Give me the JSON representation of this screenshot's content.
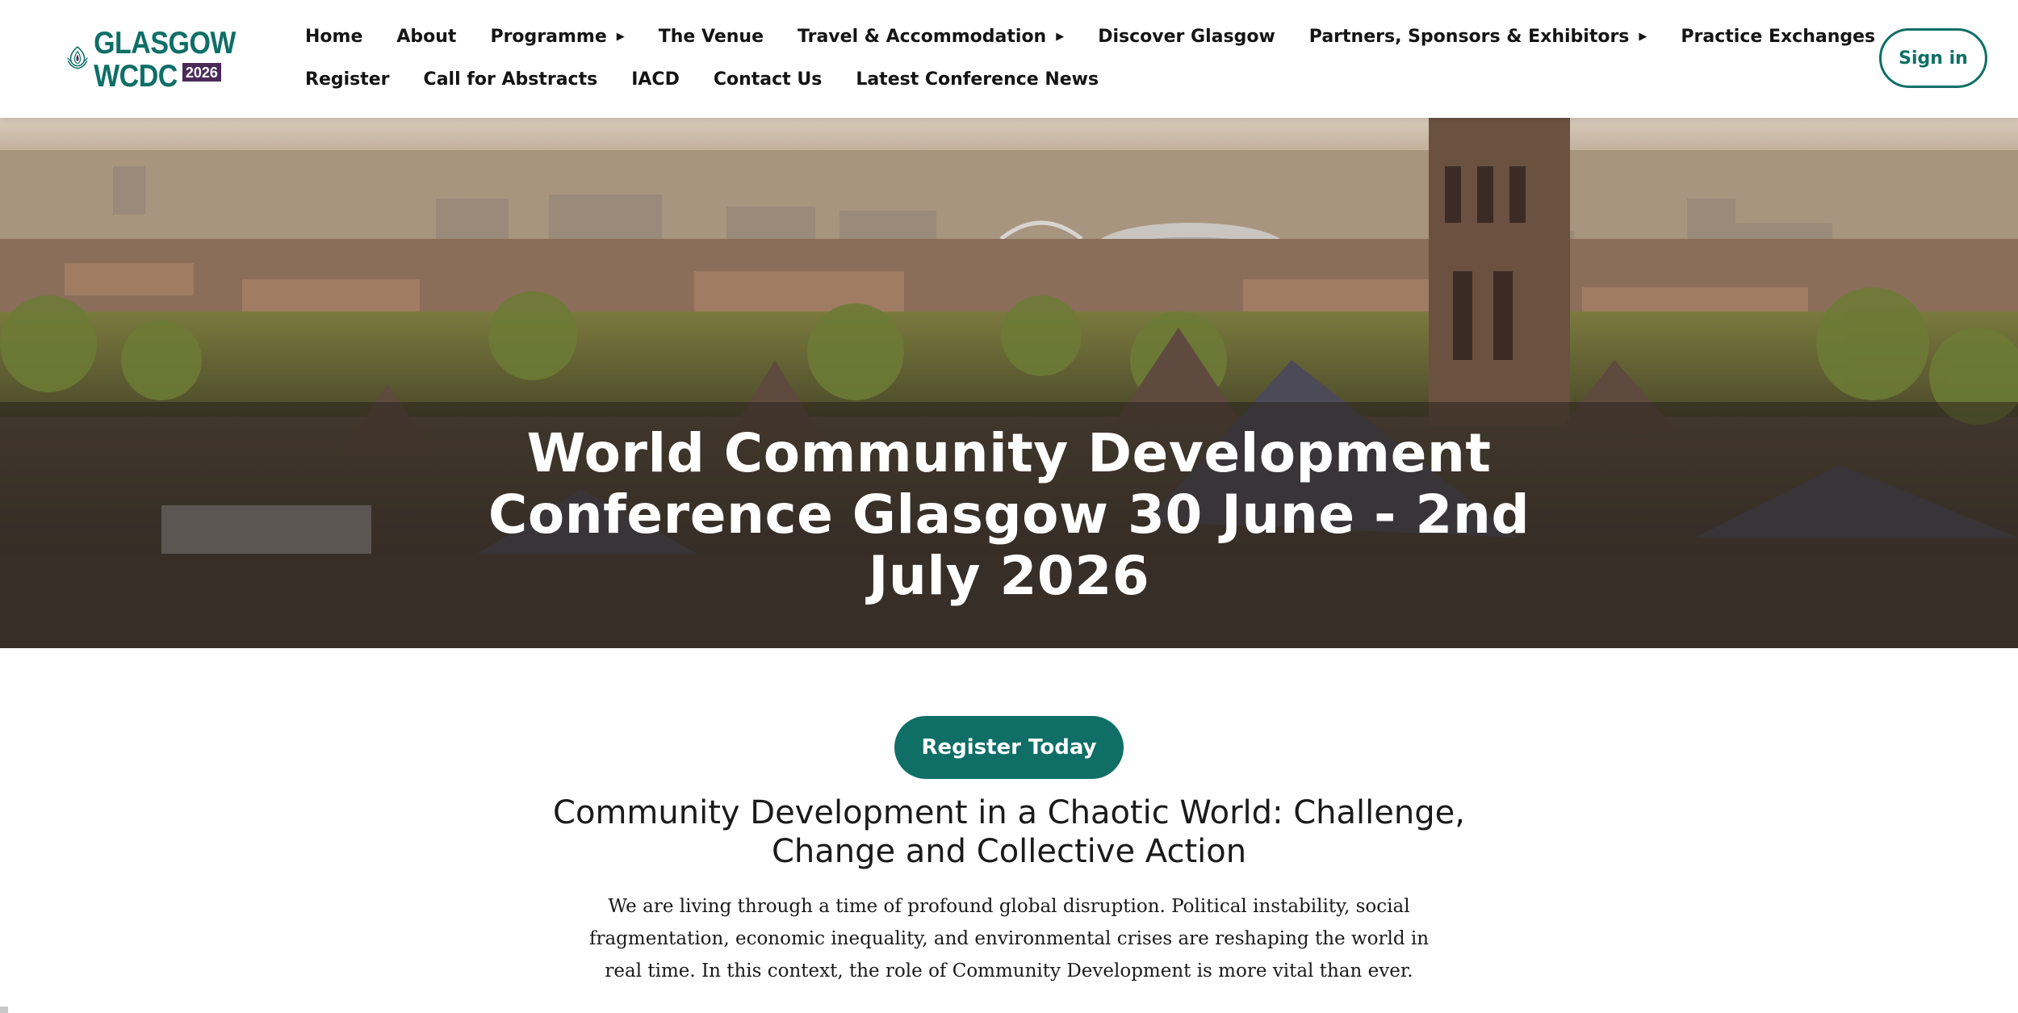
{
  "logo": {
    "line1": "GLASGOW",
    "line2": "WCDC",
    "year": "2026",
    "brand_color": "#0f6f67",
    "accent_color": "#4b2a5a"
  },
  "nav": {
    "row1": [
      {
        "label": "Home",
        "dropdown": false
      },
      {
        "label": "About",
        "dropdown": false
      },
      {
        "label": "Programme",
        "dropdown": true
      },
      {
        "label": "The Venue",
        "dropdown": false
      },
      {
        "label": "Travel & Accommodation",
        "dropdown": true
      },
      {
        "label": "Discover Glasgow",
        "dropdown": false
      },
      {
        "label": "Partners, Sponsors & Exhibitors",
        "dropdown": true
      },
      {
        "label": "Practice Exchanges",
        "dropdown": false
      }
    ],
    "row2": [
      {
        "label": "Register",
        "dropdown": false
      },
      {
        "label": "Call for Abstracts",
        "dropdown": false
      },
      {
        "label": "IACD",
        "dropdown": false
      },
      {
        "label": "Contact Us",
        "dropdown": false
      },
      {
        "label": "Latest Conference News",
        "dropdown": false
      }
    ],
    "caret_icon": "caret-right-icon"
  },
  "header": {
    "signin_label": "Sign in"
  },
  "hero": {
    "title": "World Community Development Conference Glasgow 30 June - 2nd July 2026"
  },
  "main": {
    "register_label": "Register Today",
    "subtitle": "Community Development in a Chaotic World: Challenge, Change and Collective Action",
    "intro": "We are living through a time of profound global disruption. Political instability, social fragmentation, economic inequality, and environmental crises are reshaping the world in real time. In this context, the role of Community Development is more vital than ever."
  },
  "colors": {
    "primary": "#0f6f67",
    "text": "#141414",
    "hero_band": "rgba(40,34,30,0.55)"
  }
}
